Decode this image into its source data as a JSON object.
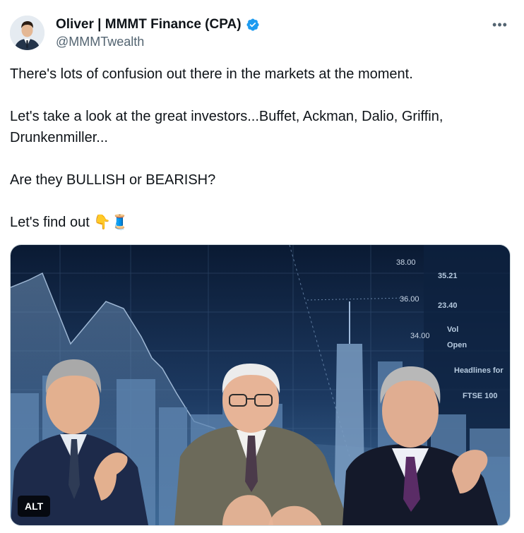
{
  "author": {
    "name": "Oliver | MMMT Finance (CPA)",
    "handle": "@MMMTwealth",
    "verified": true
  },
  "menu": {
    "more_label": "•••"
  },
  "tweet": {
    "line1": "There's lots of confusion out there in the markets at the moment.",
    "line2": "Let's take a look at the great investors...Buffet, Ackman, Dalio, Griffin, Drunkenmiller...",
    "line3": "Are they BULLISH or BEARISH?",
    "line4": "Let's find out",
    "line4_emoji": "👇🧵"
  },
  "media": {
    "alt_label": "ALT",
    "price_ticks": [
      "38.00",
      "36.00",
      "34.00"
    ],
    "panel_rows": [
      "35.21",
      "23.40",
      "Vol",
      "Open",
      "Headlines for",
      "FTSE 100"
    ]
  },
  "colors": {
    "verified": "#1d9bf0",
    "text": "#0f1419",
    "muted": "#536471",
    "sky_top": "#0a1a33",
    "sky_bottom": "#3f6d9b"
  }
}
